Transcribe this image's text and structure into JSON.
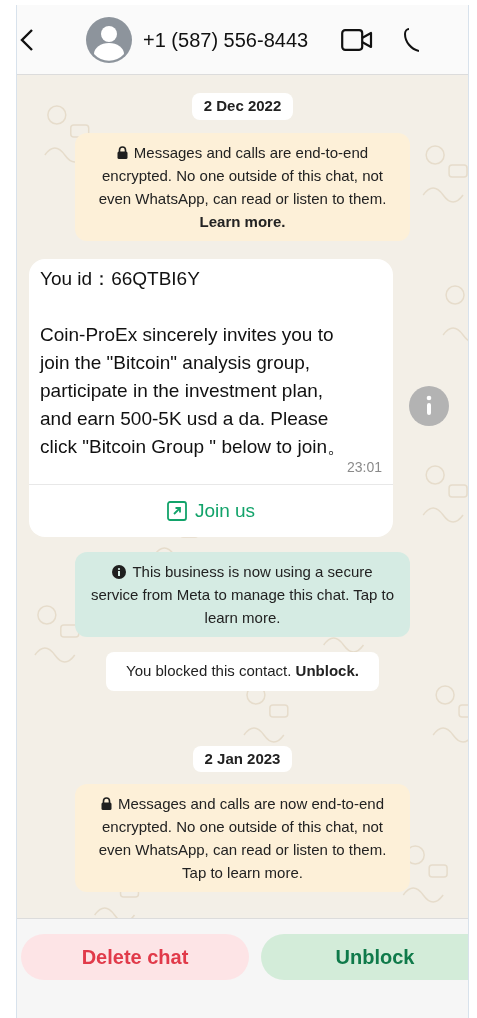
{
  "header": {
    "contact": "+1 (587) 556-8443"
  },
  "chat": [
    {
      "kind": "date",
      "text": "2 Dec 2022"
    },
    {
      "kind": "encryption",
      "text": "Messages and calls are end-to-end encrypted. No one outside of this chat, not even WhatsApp, can read or listen to them. **Learn more.**"
    },
    {
      "kind": "message",
      "text": "You id：66QTBI6Y\n\nCoin-ProEx sincerely invites you to join the \"Bitcoin\" analysis group, participate in the investment plan, and earn 500-5K usd a da. Please click \"Bitcoin Group \" below to join。",
      "time": "23:01",
      "link": "Join us"
    },
    {
      "kind": "business",
      "text": "This business is now using a secure service from Meta to manage this chat. Tap to learn more."
    },
    {
      "kind": "blocked",
      "text": "You blocked this contact. **Unblock.**"
    },
    {
      "kind": "date",
      "text": "2 Jan 2023"
    },
    {
      "kind": "encryption",
      "text": "Messages and calls are now end-to-end encrypted. No one outside of this chat, not even WhatsApp, can read or listen to them. Tap to learn more."
    }
  ],
  "footer": {
    "delete": "Delete chat",
    "unblock": "Unblock"
  }
}
